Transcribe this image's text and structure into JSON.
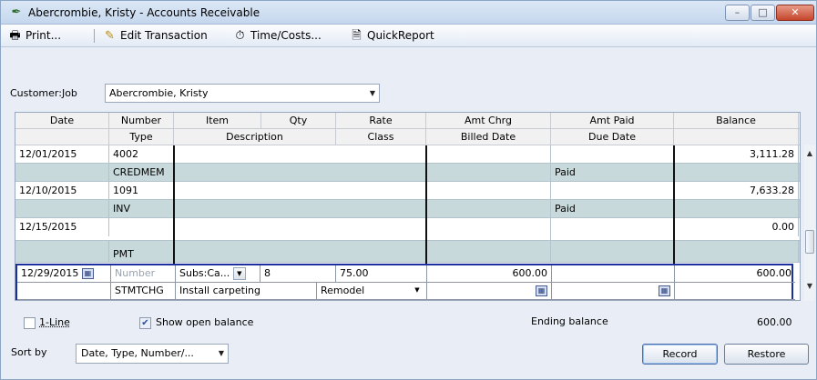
{
  "window": {
    "title": "Abercrombie, Kristy - Accounts Receivable",
    "app_icon": "register-icon",
    "controls": {
      "minimize": "–",
      "maximize": "□",
      "close": "✕"
    }
  },
  "toolbar": {
    "print_label": "Print...",
    "edit_label": "Edit Transaction",
    "time_label": "Time/Costs...",
    "report_label": "QuickReport"
  },
  "customer": {
    "label": "Customer:Job",
    "value": "Abercrombie, Kristy"
  },
  "headers": {
    "row1": [
      "Date",
      "Number",
      "Item",
      "Qty",
      "Rate",
      "Amt Chrg",
      "Amt Paid",
      "Balance"
    ],
    "row2": [
      "",
      "Type",
      "Description",
      "",
      "Class",
      "Billed Date",
      "Due Date",
      ""
    ]
  },
  "transactions": [
    {
      "date": "12/01/2015",
      "number": "4002",
      "type": "CREDMEM",
      "amt_paid_note": "Paid",
      "balance": "3,111.28"
    },
    {
      "date": "12/10/2015",
      "number": "1091",
      "type": "INV",
      "amt_paid_note": "Paid",
      "balance": "7,633.28"
    },
    {
      "date": "12/15/2015",
      "number": "",
      "type": "PMT",
      "amt_paid_note": "",
      "balance": "0.00"
    }
  ],
  "edit_row": {
    "date": "12/29/2015",
    "number_placeholder": "Number",
    "item": "Subs:Ca...",
    "qty": "8",
    "rate": "75.00",
    "amt_chrg": "600.00",
    "balance": "600.00",
    "type": "STMTCHG",
    "description": "Install carpeting",
    "class": "Remodel"
  },
  "options": {
    "one_line_label": "1-Line",
    "one_line_checked": false,
    "show_open_balance_label": "Show open balance",
    "show_open_balance_checked": true
  },
  "ending_balance": {
    "label": "Ending balance",
    "value": "600.00"
  },
  "sort": {
    "label": "Sort by",
    "value": "Date, Type, Number/..."
  },
  "buttons": {
    "record": "Record",
    "restore": "Restore"
  },
  "colors": {
    "alt_row": "#c7d9da",
    "edit_border": "#1b2f9e"
  }
}
